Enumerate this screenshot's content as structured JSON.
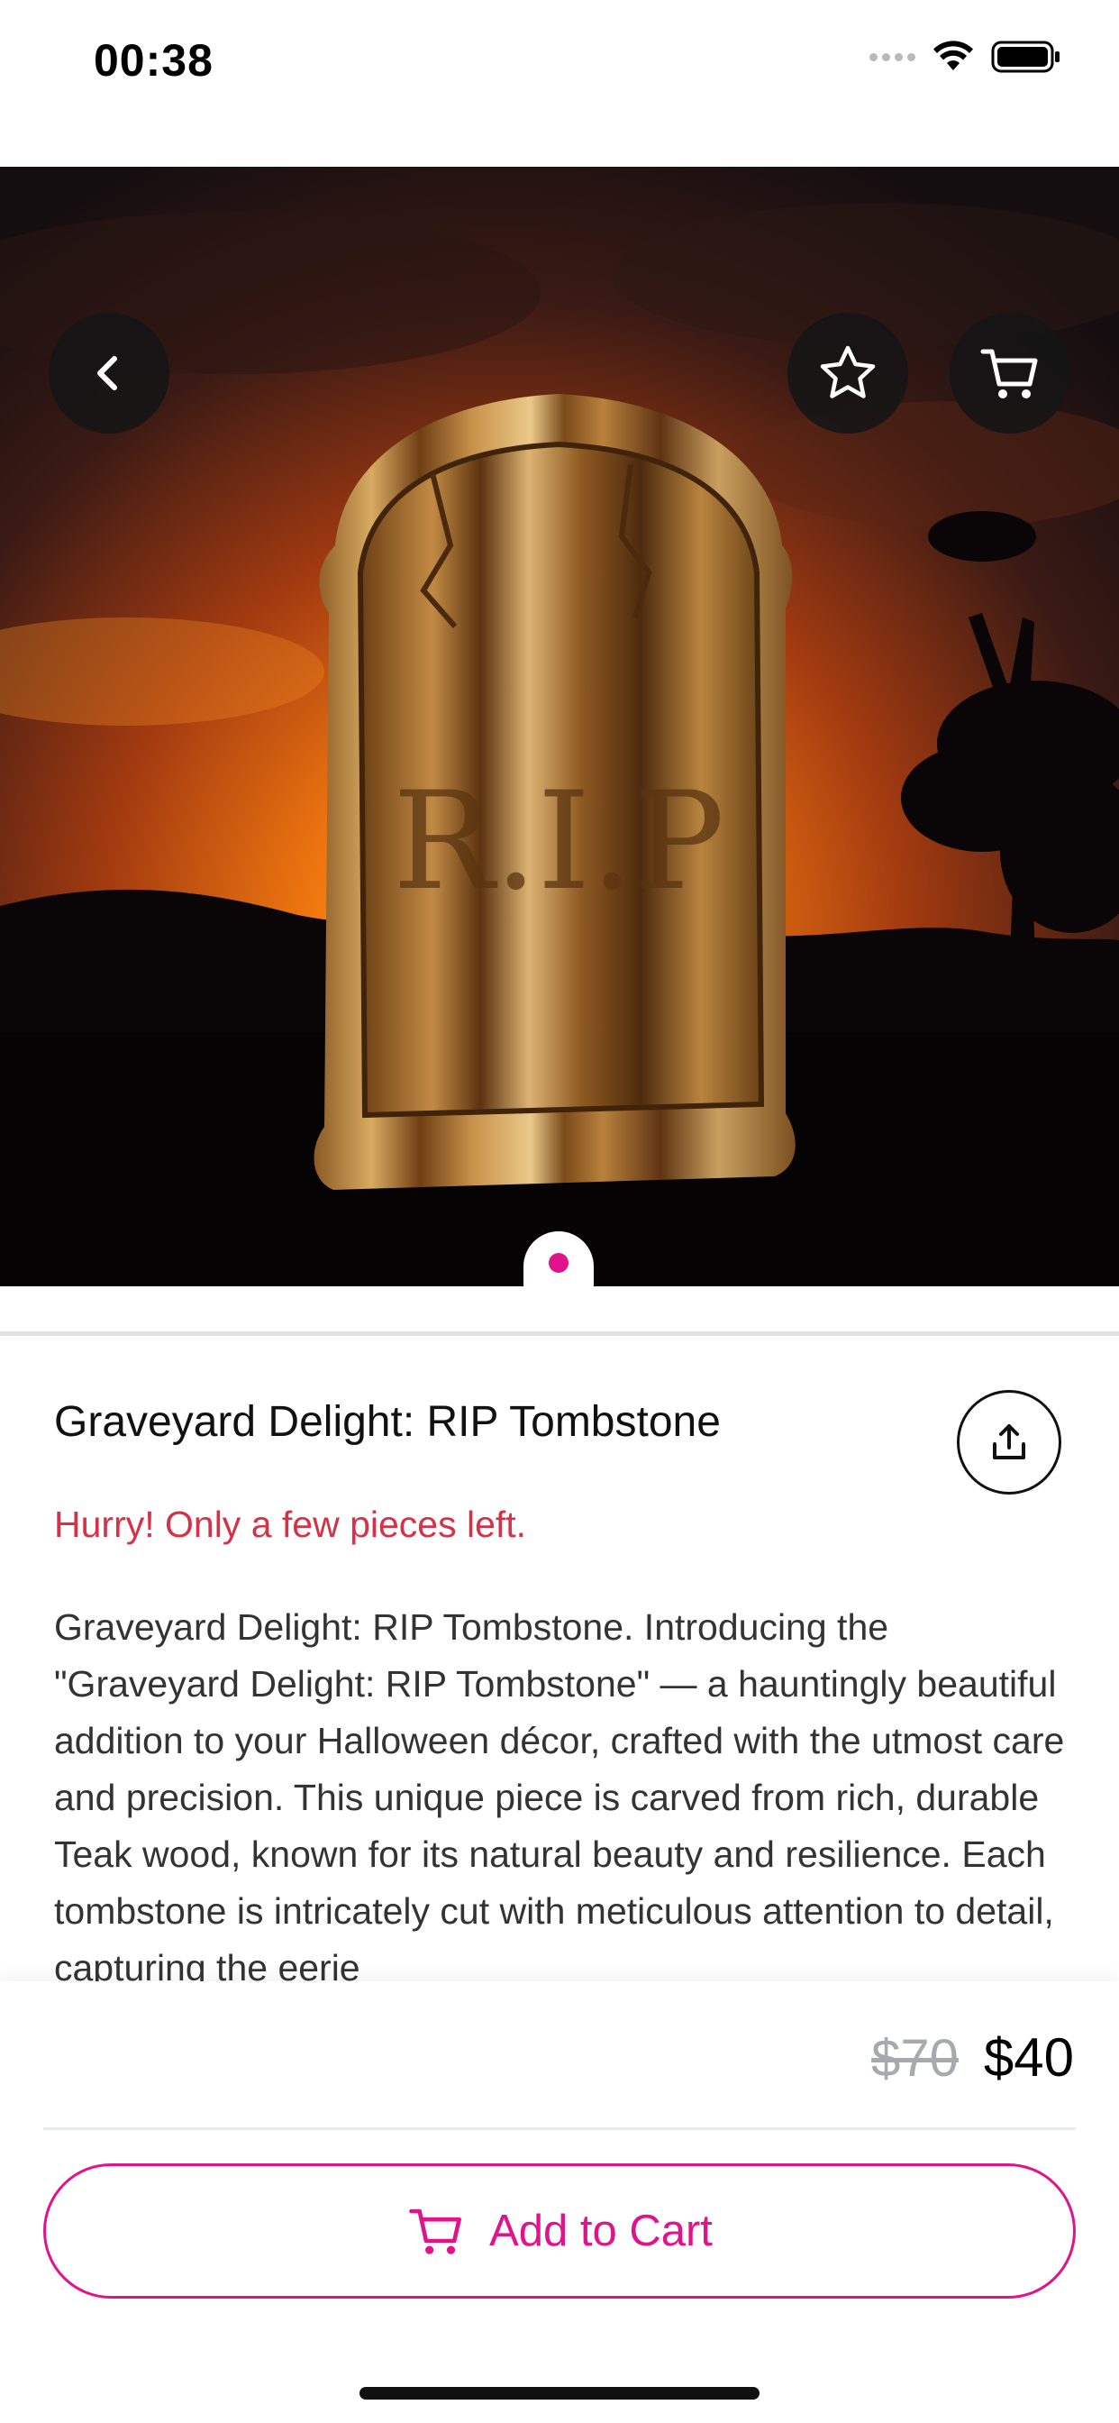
{
  "status_bar": {
    "time": "00:38"
  },
  "product": {
    "title": "Graveyard Delight: RIP Tombstone",
    "stock_warning": "Hurry! Only a few pieces left.",
    "description": "Graveyard Delight: RIP Tombstone. Introducing the \"Graveyard Delight: RIP Tombstone\" — a hauntingly beautiful addition to your Halloween décor, crafted with the utmost care and precision. This unique piece is carved from rich, durable Teak wood, known for its natural beauty and resilience. Each tombstone is intricately cut with meticulous attention to detail, capturing the eerie",
    "image_carving_text": "R.I.P",
    "old_price": "$70",
    "new_price": "$40"
  },
  "gallery": {
    "image_count": 1,
    "current_index": 1
  },
  "actions": {
    "add_to_cart_label": "Add to Cart"
  },
  "icons": {
    "back": "chevron-left-icon",
    "favorite": "star-icon",
    "cart": "shopping-cart-icon",
    "share": "share-upload-icon"
  },
  "colors": {
    "accent": "#e0138c",
    "warning": "#d63247",
    "old_price": "#a6a9ad",
    "overlay_button": "#141416"
  }
}
